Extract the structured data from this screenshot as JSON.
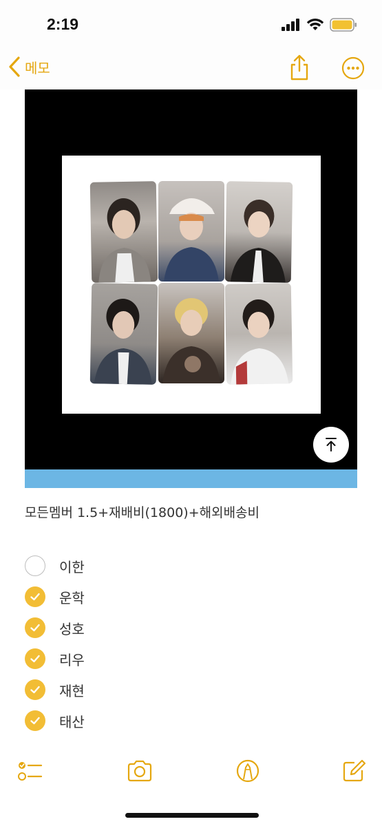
{
  "status_bar": {
    "time": "2:19"
  },
  "nav": {
    "back_label": "메모"
  },
  "note": {
    "text": "모든멤버 1.5+재배비(1800)+해외배송비",
    "checklist": [
      {
        "label": "이한",
        "checked": false
      },
      {
        "label": "운학",
        "checked": true
      },
      {
        "label": "성호",
        "checked": true
      },
      {
        "label": "리우",
        "checked": true
      },
      {
        "label": "재현",
        "checked": true
      },
      {
        "label": "태산",
        "checked": true
      }
    ]
  },
  "colors": {
    "accent": "#e5a70f",
    "check_fill": "#f2bd35",
    "blue_bar": "#6cb6e4"
  },
  "icons": [
    "cellular-signal-icon",
    "wifi-icon",
    "battery-icon",
    "chevron-left-icon",
    "share-icon",
    "more-icon",
    "scroll-to-top-icon",
    "checklist-icon",
    "camera-icon",
    "markup-icon",
    "compose-icon"
  ]
}
